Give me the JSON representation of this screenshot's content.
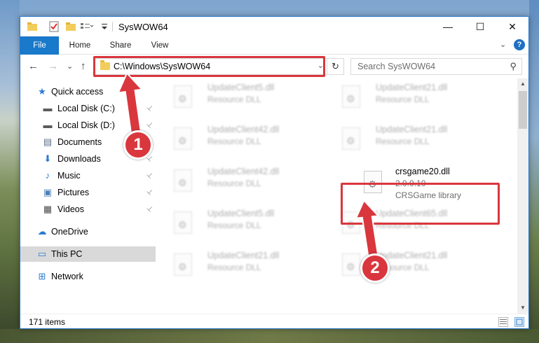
{
  "window": {
    "title": "SysWOW64",
    "minimize_glyph": "—",
    "maximize_glyph": "☐",
    "close_glyph": "✕"
  },
  "ribbon": {
    "tabs": [
      "File",
      "Home",
      "Share",
      "View"
    ],
    "expand_glyph": "⌄",
    "help_glyph": "?"
  },
  "nav": {
    "back_glyph": "←",
    "forward_glyph": "→",
    "recent_glyph": "⌄",
    "up_glyph": "↑",
    "address": "C:\\Windows\\SysWOW64",
    "address_dropdown_glyph": "⌄",
    "refresh_glyph": "↻",
    "search_placeholder": "Search SysWOW64",
    "search_icon_glyph": "⚲"
  },
  "sidebar": {
    "pin_glyph": "📌",
    "items": [
      {
        "label": "Quick access",
        "icon": "star-icon",
        "glyph": "★",
        "color": "#2a7bd1"
      },
      {
        "label": "Local Disk (C:)",
        "icon": "drive-icon",
        "glyph": "▬",
        "color": "#5a5a5a"
      },
      {
        "label": "Local Disk (D:)",
        "icon": "drive-icon",
        "glyph": "▬",
        "color": "#5a5a5a"
      },
      {
        "label": "Documents",
        "icon": "document-icon",
        "glyph": "▤",
        "color": "#5a6f8a"
      },
      {
        "label": "Downloads",
        "icon": "download-icon",
        "glyph": "⬇",
        "color": "#2a7bd1"
      },
      {
        "label": "Music",
        "icon": "music-icon",
        "glyph": "♪",
        "color": "#2a7bd1"
      },
      {
        "label": "Pictures",
        "icon": "pictures-icon",
        "glyph": "▣",
        "color": "#4e7fb5"
      },
      {
        "label": "Videos",
        "icon": "videos-icon",
        "glyph": "▦",
        "color": "#4a4a4a"
      },
      {
        "label": "OneDrive",
        "icon": "cloud-icon",
        "glyph": "☁",
        "color": "#2a7bd1"
      },
      {
        "label": "This PC",
        "icon": "computer-icon",
        "glyph": "▭",
        "color": "#2a7bd1"
      },
      {
        "label": "Network",
        "icon": "network-icon",
        "glyph": "⊞",
        "color": "#2a7bd1"
      }
    ]
  },
  "files": [
    {
      "name": "UpdateClient5.dll",
      "sub": "Resource DLL"
    },
    {
      "name": "UpdateClient21.dll",
      "sub": "Resource DLL"
    },
    {
      "name": "UpdateClient42.dll",
      "sub": "Resource DLL"
    },
    {
      "name": "UpdateClient21.dll",
      "sub": "Resource DLL"
    },
    {
      "name": "UpdateClient42.dll",
      "sub": "Resource DLL"
    },
    {
      "name": "UpdateClient5.dll",
      "sub": "Resource DLL"
    },
    {
      "name": "UpdateClient65.dll",
      "sub": "Resource DLL"
    },
    {
      "name": "UpdateClient21.dll",
      "sub": "Resource DLL"
    },
    {
      "name": "UpdateClient21.dll",
      "sub": "Resource DLL"
    }
  ],
  "highlighted_file": {
    "name": "crsgame20.dll",
    "version": "2.0.0.10",
    "description": "CRSGame library"
  },
  "status": {
    "item_count": "171 items"
  },
  "annotations": {
    "step1": "1",
    "step2": "2",
    "color": "#d9373d"
  }
}
